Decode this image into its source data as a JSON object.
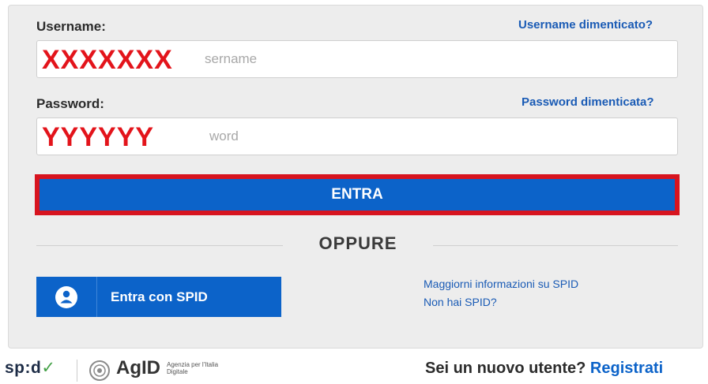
{
  "username": {
    "label": "Username:",
    "forgot_link": "Username dimenticato?",
    "placeholder": "Inserisci il tuo username",
    "placeholder_visible": "sername",
    "value": "XXXXXXX"
  },
  "password": {
    "label": "Password:",
    "forgot_link": "Password dimenticata?",
    "placeholder": "Inserisci la tua password",
    "placeholder_visible": "word",
    "value": "YYYYYY"
  },
  "login_button": "ENTRA",
  "separator": "OPPURE",
  "spid": {
    "button_label": "Entra con SPID",
    "more_info": "Maggiorni informazioni su SPID",
    "no_spid": "Non hai SPID?"
  },
  "footer": {
    "spid_logo": "sp:d",
    "agid_logo": "AgID",
    "agid_subtitle": "Agenzia per l'Italia Digitale",
    "new_user_text": "Sei un nuovo utente?",
    "register_link": "Registrati"
  },
  "colors": {
    "primary": "#0c63c9",
    "highlight": "#d7141f",
    "link": "#1a5bb5"
  }
}
